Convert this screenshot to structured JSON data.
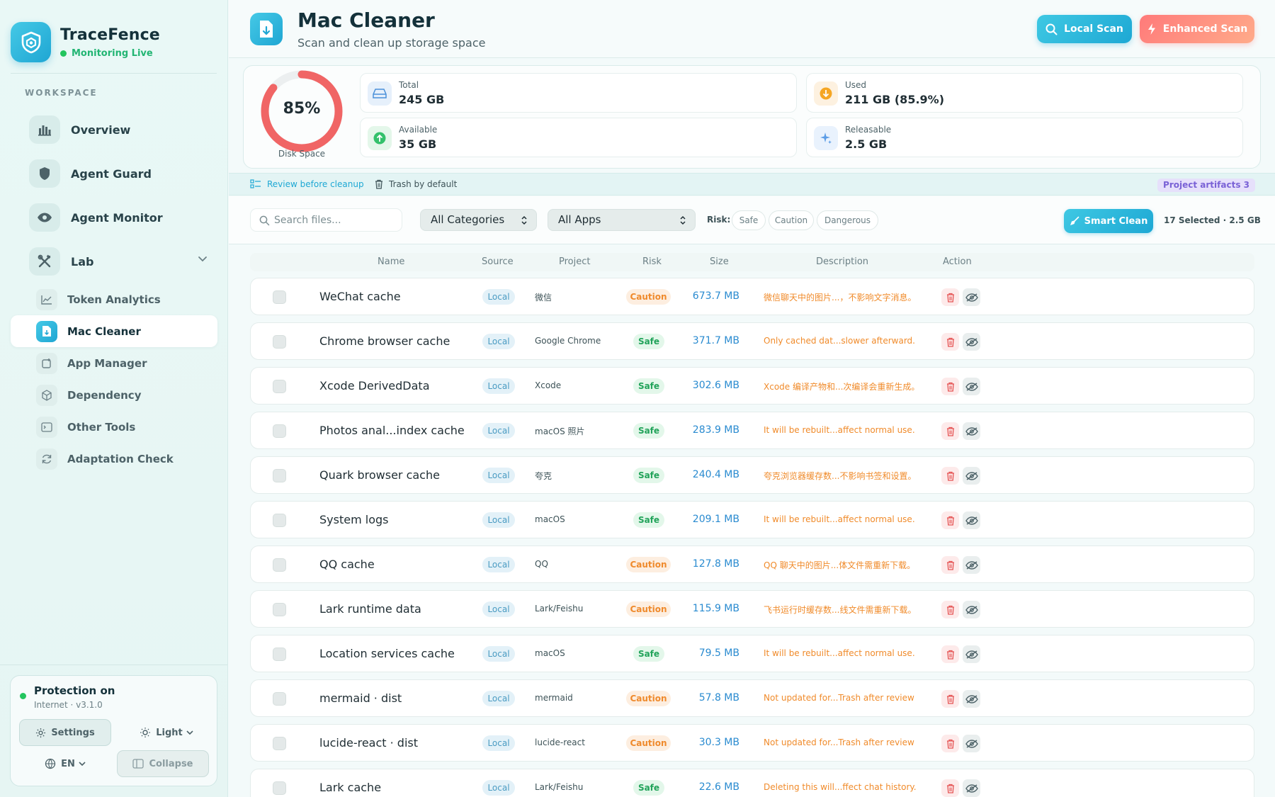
{
  "sidebar": {
    "brand_name": "TraceFence",
    "brand_status": "Monitoring Live",
    "section_label": "WORKSPACE",
    "main_items": [
      {
        "label": "Overview",
        "icon": "bar-chart-icon"
      },
      {
        "label": "Agent Guard",
        "icon": "shield-icon"
      },
      {
        "label": "Agent Monitor",
        "icon": "eye-icon"
      },
      {
        "label": "Lab",
        "icon": "tools-icon"
      }
    ],
    "sub_items": [
      {
        "label": "Token Analytics",
        "icon": "line-chart-icon"
      },
      {
        "label": "Mac Cleaner",
        "icon": "file-download-icon",
        "active": true
      },
      {
        "label": "App Manager",
        "icon": "app-box-icon"
      },
      {
        "label": "Dependency",
        "icon": "cube-icon"
      },
      {
        "label": "Other Tools",
        "icon": "terminal-icon"
      },
      {
        "label": "Adaptation Check",
        "icon": "refresh-icon"
      }
    ],
    "protection": {
      "title": "Protection on",
      "subtitle": "Internet · v3.1.0",
      "settings_label": "Settings",
      "theme_label": "Light",
      "lang_label": "EN",
      "collapse_label": "Collapse"
    }
  },
  "header": {
    "title": "Mac Cleaner",
    "subtitle": "Scan and clean up storage space",
    "local_scan_label": "Local Scan",
    "enhanced_scan_label": "Enhanced Scan"
  },
  "disk": {
    "percent_label": "85%",
    "percent_value": 0.859,
    "gauge_label": "Disk Space",
    "stats": [
      {
        "label": "Total",
        "value": "245 GB"
      },
      {
        "label": "Used",
        "value": "211 GB (85.9%)"
      },
      {
        "label": "Available",
        "value": "35 GB"
      },
      {
        "label": "Releasable",
        "value": "2.5 GB"
      }
    ]
  },
  "strip": {
    "review_label": "Review before cleanup",
    "trash_label": "Trash by default",
    "artifacts_label": "Project artifacts 3"
  },
  "filters": {
    "search_placeholder": "Search files...",
    "category_value": "All Categories",
    "app_value": "All Apps",
    "risk_label": "Risk:",
    "risk_chips": [
      "Safe",
      "Caution",
      "Dangerous"
    ],
    "smart_clean_label": "Smart Clean",
    "selected_info": "17 Selected · 2.5 GB"
  },
  "table": {
    "columns": [
      "Name",
      "Source",
      "Project",
      "Risk",
      "Size",
      "Description",
      "Action"
    ],
    "rows": [
      {
        "name": "WeChat cache",
        "source": "Local",
        "project": "微信",
        "risk": "Caution",
        "size": "673.7 MB",
        "desc": "微信聊天中的图片...，不影响文字消息。"
      },
      {
        "name": "Chrome browser cache",
        "source": "Local",
        "project": "Google Chrome",
        "risk": "Safe",
        "size": "371.7 MB",
        "desc": "Only cached dat...slower afterward."
      },
      {
        "name": "Xcode DerivedData",
        "source": "Local",
        "project": "Xcode",
        "risk": "Safe",
        "size": "302.6 MB",
        "desc": "Xcode 编译产物和...次编译会重新生成。"
      },
      {
        "name": "Photos anal...index cache",
        "source": "Local",
        "project": "macOS 照片",
        "risk": "Safe",
        "size": "283.9 MB",
        "desc": "It will be rebuilt...affect normal use."
      },
      {
        "name": "Quark browser cache",
        "source": "Local",
        "project": "夸克",
        "risk": "Safe",
        "size": "240.4 MB",
        "desc": "夸克浏览器缓存数...不影响书签和设置。"
      },
      {
        "name": "System logs",
        "source": "Local",
        "project": "macOS",
        "risk": "Safe",
        "size": "209.1 MB",
        "desc": "It will be rebuilt...affect normal use."
      },
      {
        "name": "QQ cache",
        "source": "Local",
        "project": "QQ",
        "risk": "Caution",
        "size": "127.8 MB",
        "desc": "QQ 聊天中的图片...体文件需重新下载。"
      },
      {
        "name": "Lark runtime data",
        "source": "Local",
        "project": "Lark/Feishu",
        "risk": "Caution",
        "size": "115.9 MB",
        "desc": "飞书运行时缓存数...线文件需重新下载。"
      },
      {
        "name": "Location services cache",
        "source": "Local",
        "project": "macOS",
        "risk": "Safe",
        "size": "79.5 MB",
        "desc": "It will be rebuilt...affect normal use."
      },
      {
        "name": "mermaid · dist",
        "source": "Local",
        "project": "mermaid",
        "risk": "Caution",
        "size": "57.8 MB",
        "desc": "Not updated for...Trash after review"
      },
      {
        "name": "lucide-react · dist",
        "source": "Local",
        "project": "lucide-react",
        "risk": "Caution",
        "size": "30.3 MB",
        "desc": "Not updated for...Trash after review"
      },
      {
        "name": "Lark cache",
        "source": "Local",
        "project": "Lark/Feishu",
        "risk": "Safe",
        "size": "22.6 MB",
        "desc": "Deleting this will...ffect chat history."
      }
    ]
  },
  "colors": {
    "accent": "#1ea8d4",
    "danger_gradient": "#ff7a7a",
    "gauge": "#f06565",
    "safe": "#22a35a",
    "caution": "#ef8a2c"
  }
}
